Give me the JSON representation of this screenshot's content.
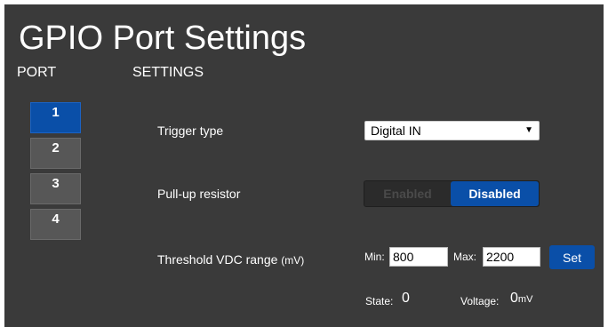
{
  "page": {
    "title": "GPIO Port Settings"
  },
  "headers": {
    "port": "PORT",
    "settings": "SETTINGS"
  },
  "ports": [
    {
      "label": "1",
      "active": true
    },
    {
      "label": "2",
      "active": false
    },
    {
      "label": "3",
      "active": false
    },
    {
      "label": "4",
      "active": false
    }
  ],
  "trigger": {
    "label": "Trigger type",
    "value": "Digital IN",
    "arrow": "▼"
  },
  "pullup": {
    "label": "Pull-up resistor",
    "enabled_label": "Enabled",
    "disabled_label": "Disabled",
    "selected": "Disabled"
  },
  "threshold": {
    "label": "Threshold VDC range",
    "unit": "(mV)",
    "min_label": "Min:",
    "min_value": "800",
    "max_label": "Max:",
    "max_value": "2200",
    "set_label": "Set"
  },
  "status": {
    "state_label": "State:",
    "state_value": "0",
    "voltage_label": "Voltage:",
    "voltage_value": "0",
    "voltage_unit": "mV"
  },
  "colors": {
    "accent": "#0a4fa8",
    "panel": "#3a3a3a",
    "idle_port": "#575757"
  }
}
